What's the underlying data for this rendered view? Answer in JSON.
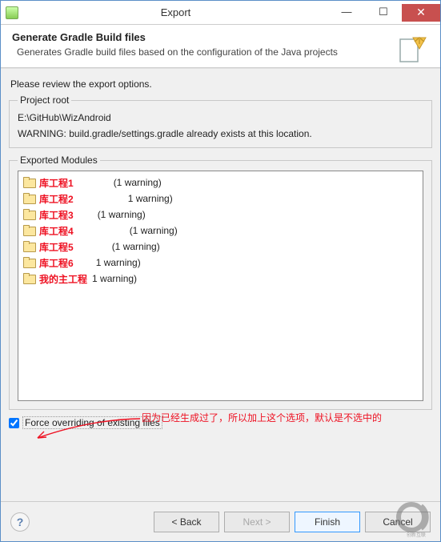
{
  "window": {
    "title": "Export",
    "min": "—",
    "max": "☐",
    "close": "✕"
  },
  "banner": {
    "heading": "Generate Gradle Build files",
    "desc": "Generates Gradle build files based on the configuration of the Java projects"
  },
  "instruction": "Please review the export options.",
  "project_root": {
    "legend": "Project root",
    "path": "E:\\GitHub\\WizAndroid",
    "warning": "WARNING: build.gradle/settings.gradle already exists at this location."
  },
  "exported": {
    "legend": "Exported Modules",
    "items": [
      {
        "label": "库工程1",
        "pad": 48,
        "suffix": "(1 warning)"
      },
      {
        "label": "库工程2",
        "pad": 66,
        "suffix": "1 warning)"
      },
      {
        "label": "库工程3",
        "pad": 28,
        "suffix": "(1 warning)"
      },
      {
        "label": "库工程4",
        "pad": 68,
        "suffix": "(1 warning)"
      },
      {
        "label": "库工程5",
        "pad": 46,
        "suffix": "(1 warning)"
      },
      {
        "label": "库工程6",
        "pad": 26,
        "suffix": "1 warning)"
      },
      {
        "label": "我的主工程",
        "pad": 4,
        "suffix": "1 warning)"
      }
    ]
  },
  "annotation": "因为已经生成过了，所以加上这个选项，默认是不选中的",
  "checkbox": {
    "label": "Force overriding of existing files",
    "checked": true
  },
  "buttons": {
    "back": "< Back",
    "next": "Next >",
    "finish": "Finish",
    "cancel": "Cancel"
  },
  "watermark": "创新互联"
}
